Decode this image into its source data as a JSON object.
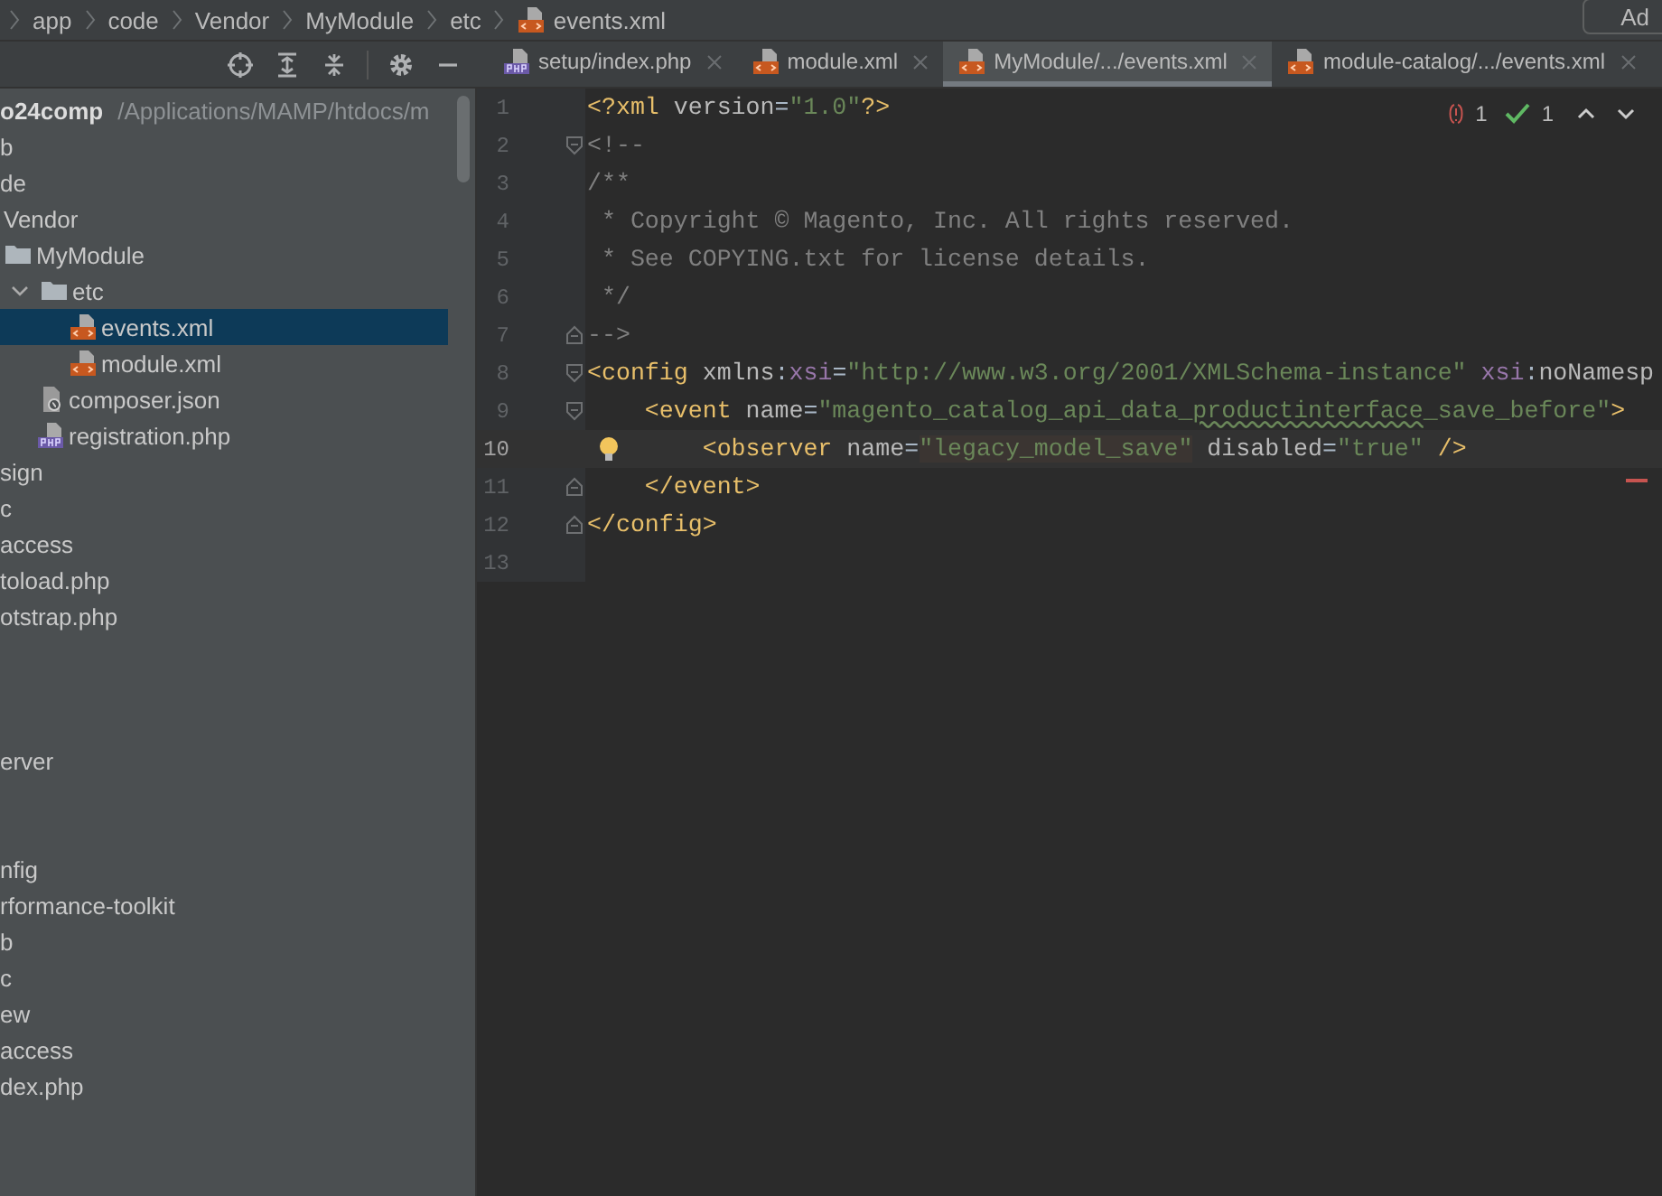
{
  "breadcrumbs": [
    {
      "label": "app",
      "kind": "dir"
    },
    {
      "label": "code",
      "kind": "dir"
    },
    {
      "label": "Vendor",
      "kind": "dir"
    },
    {
      "label": "MyModule",
      "kind": "dir"
    },
    {
      "label": "etc",
      "kind": "dir"
    },
    {
      "label": "events.xml",
      "kind": "xml"
    }
  ],
  "top_button": {
    "label": "Ad"
  },
  "tool_window_toolbar": [
    {
      "kind": "locate"
    },
    {
      "kind": "expand"
    },
    {
      "kind": "collapse"
    },
    {
      "kind": "gear"
    },
    {
      "kind": "hide"
    }
  ],
  "tabs": [
    {
      "label": "setup/index.php",
      "kind": "php",
      "selected": false
    },
    {
      "label": "module.xml",
      "kind": "xml",
      "selected": false
    },
    {
      "label": "MyModule/.../events.xml",
      "kind": "xml",
      "selected": true
    },
    {
      "label": "module-catalog/.../events.xml",
      "kind": "xml",
      "selected": false
    }
  ],
  "project_tree": [
    {
      "label": "o24comp",
      "path": "/Applications/MAMP/htdocs/m",
      "kind": "root",
      "selected": false
    },
    {
      "label": "b",
      "selected": false
    },
    {
      "label": "de",
      "selected": false,
      "children": [
        {
          "label": "Vendor",
          "kind": "folder",
          "selected": false,
          "children": [
            {
              "label": "MyModule",
              "kind": "folder",
              "selected": false,
              "children": [
                {
                  "label": "etc",
                  "kind": "folder",
                  "selected": false,
                  "expanded": true,
                  "children": [
                    {
                      "label": "events.xml",
                      "kind": "xml",
                      "selected": true
                    },
                    {
                      "label": "module.xml",
                      "kind": "xml",
                      "selected": false
                    }
                  ]
                },
                {
                  "label": "composer.json",
                  "kind": "json",
                  "selected": false
                },
                {
                  "label": "registration.php",
                  "kind": "php",
                  "selected": false
                }
              ]
            }
          ]
        }
      ]
    },
    {
      "label": "sign",
      "selected": false
    },
    {
      "label": "c",
      "selected": false
    },
    {
      "label": "access",
      "selected": false
    },
    {
      "label": "toload.php",
      "selected": false
    },
    {
      "label": "otstrap.php",
      "selected": false
    },
    {
      "kind": "blank",
      "selected": false
    },
    {
      "kind": "blank",
      "selected": false
    },
    {
      "kind": "blank",
      "selected": false
    },
    {
      "label": "erver",
      "selected": false
    },
    {
      "kind": "blank",
      "selected": false
    },
    {
      "kind": "blank",
      "selected": false
    },
    {
      "label": "nfig",
      "selected": false
    },
    {
      "label": "rformance-toolkit",
      "selected": false
    },
    {
      "label": "b",
      "selected": false
    },
    {
      "label": "c",
      "selected": false
    },
    {
      "label": "ew",
      "selected": false
    },
    {
      "label": "access",
      "selected": false
    },
    {
      "label": "dex.php",
      "selected": false
    }
  ],
  "inspections": {
    "errors": "1",
    "checks": "1"
  },
  "editor_lines": [
    {
      "number": "1",
      "current": false,
      "tokens": [
        {
          "kind": "tag",
          "text": "<?xml"
        },
        {
          "kind": "attr",
          "text": " version"
        },
        {
          "kind": "punct",
          "text": "="
        },
        {
          "kind": "value",
          "text": "\"1.0\""
        },
        {
          "kind": "tag",
          "text": "?>"
        }
      ]
    },
    {
      "number": "2",
      "current": false,
      "kind": "open",
      "tokens": [
        {
          "kind": "comment",
          "text": "<!--"
        }
      ]
    },
    {
      "number": "3",
      "current": false,
      "tokens": [
        {
          "kind": "comment",
          "text": "/**"
        }
      ]
    },
    {
      "number": "4",
      "current": false,
      "tokens": [
        {
          "kind": "comment",
          "text": " * Copyright © Magento, Inc. All rights reserved."
        }
      ]
    },
    {
      "number": "5",
      "current": false,
      "tokens": [
        {
          "kind": "comment",
          "text": " * See COPYING.txt for license details."
        }
      ]
    },
    {
      "number": "6",
      "current": false,
      "tokens": [
        {
          "kind": "comment",
          "text": " */"
        }
      ]
    },
    {
      "number": "7",
      "current": false,
      "kind": "close",
      "tokens": [
        {
          "kind": "comment",
          "text": "-->"
        }
      ]
    },
    {
      "number": "8",
      "current": false,
      "kind": "open",
      "tokens": [
        {
          "kind": "tag",
          "text": "<config"
        },
        {
          "kind": "attr",
          "text": " xmlns"
        },
        {
          "kind": "punct",
          "text": ":"
        },
        {
          "kind": "ns",
          "text": "xsi"
        },
        {
          "kind": "punct",
          "text": "="
        },
        {
          "kind": "value",
          "text": "\"http://www.w3.org/2001/XMLSchema-instance\""
        },
        {
          "kind": "ns",
          "text": " xsi"
        },
        {
          "kind": "punct",
          "text": ":"
        },
        {
          "kind": "attr",
          "text": "noNamesp"
        }
      ]
    },
    {
      "number": "9",
      "current": false,
      "kind": "open",
      "tokens": [
        {
          "kind": "tag",
          "text": "    <event"
        },
        {
          "kind": "attr",
          "text": " name"
        },
        {
          "kind": "punct",
          "text": "="
        },
        {
          "kind": "value",
          "text": "\"magento_catalog_api_data_"
        },
        {
          "kind": "typo",
          "text": "productinterface"
        },
        {
          "kind": "value",
          "text": "_save_before\""
        },
        {
          "kind": "tag",
          "text": ">"
        }
      ]
    },
    {
      "number": "10",
      "current": true,
      "kind": "bulb",
      "tokens": [
        {
          "kind": "tag",
          "text": "        <observer"
        },
        {
          "kind": "attr",
          "text": " name"
        },
        {
          "kind": "punct",
          "text": "="
        },
        {
          "kind": "match",
          "text": "\"legacy_model_save\""
        },
        {
          "kind": "attr",
          "text": " disabled"
        },
        {
          "kind": "punct",
          "text": "="
        },
        {
          "kind": "value",
          "text": "\"true\""
        },
        {
          "kind": "tag",
          "text": " />"
        }
      ]
    },
    {
      "number": "11",
      "current": false,
      "kind": "close",
      "tokens": [
        {
          "kind": "tag",
          "text": "    </event>"
        }
      ]
    },
    {
      "number": "12",
      "current": false,
      "kind": "close",
      "tokens": [
        {
          "kind": "tag",
          "text": "</config>"
        }
      ]
    },
    {
      "number": "13",
      "current": false
    }
  ]
}
